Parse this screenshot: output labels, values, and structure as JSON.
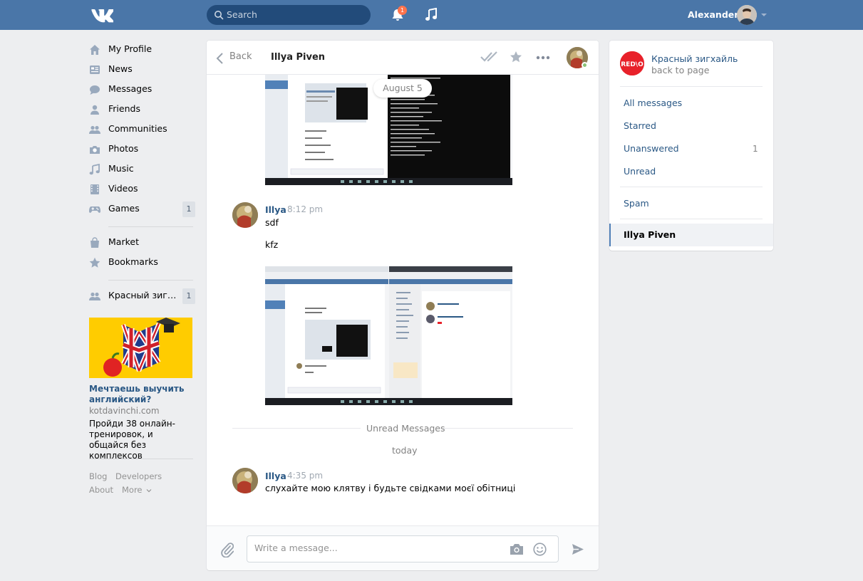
{
  "header": {
    "search_placeholder": "Search",
    "notification_count": "1",
    "user_name": "Alexander"
  },
  "sidebar": {
    "items": [
      {
        "label": "My Profile",
        "icon": "home-icon"
      },
      {
        "label": "News",
        "icon": "news-icon"
      },
      {
        "label": "Messages",
        "icon": "messages-icon"
      },
      {
        "label": "Friends",
        "icon": "friends-icon"
      },
      {
        "label": "Communities",
        "icon": "communities-icon"
      },
      {
        "label": "Photos",
        "icon": "camera-icon"
      },
      {
        "label": "Music",
        "icon": "music-icon"
      },
      {
        "label": "Videos",
        "icon": "film-icon"
      },
      {
        "label": "Games",
        "icon": "gamepad-icon",
        "badge": "1"
      },
      {
        "label": "Market",
        "icon": "bag-icon"
      },
      {
        "label": "Bookmarks",
        "icon": "star-icon"
      },
      {
        "label": "Красный зигхайль",
        "icon": "community-icon",
        "badge": "1"
      }
    ],
    "ad": {
      "title": "Мечтаешь выучить английский?",
      "domain": "kotdavinchi.com",
      "text": "Пройди 38 онлайн-тренировок, и общайся без комплексов"
    },
    "footer": {
      "blog": "Blog",
      "developers": "Developers",
      "about": "About",
      "more": "More"
    }
  },
  "chat": {
    "back_label": "Back",
    "title": "Illya Piven",
    "date_divider": "August 5",
    "messages": [
      {
        "author": "Illya",
        "time": "8:12 pm",
        "lines": [
          "sdf",
          "kfz"
        ]
      },
      {
        "author": "Illya",
        "time": "4:35 pm",
        "lines": [
          "слухайте мою клятву і будьте свідками моєї обітниці"
        ]
      }
    ],
    "unread_label": "Unread Messages",
    "today_label": "today",
    "input_placeholder": "Write a message..."
  },
  "right_panel": {
    "group_name": "Красный зигхайль",
    "group_logo_text": "RED\\O",
    "back_to_page": "back to page",
    "filters": [
      {
        "label": "All messages"
      },
      {
        "label": "Starred"
      },
      {
        "label": "Unanswered",
        "count": "1"
      },
      {
        "label": "Unread"
      },
      {
        "label": "Spam"
      }
    ],
    "active_chat": "Illya Piven"
  },
  "colors": {
    "brand_blue": "#4a76a8",
    "link_blue": "#2a5885",
    "page_bg": "#edeef0",
    "badge_red": "#ff734c",
    "online_green": "#8ac176"
  }
}
